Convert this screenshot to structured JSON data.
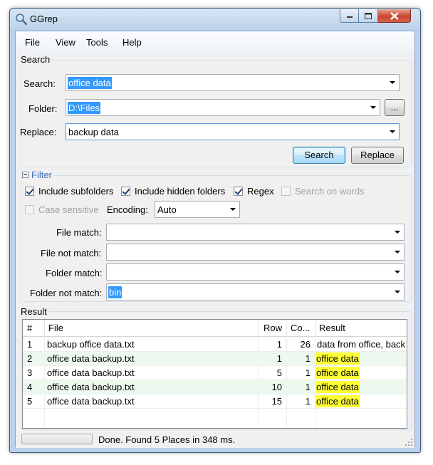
{
  "window": {
    "title": "GGrep"
  },
  "menu": [
    "File",
    "View",
    "Tools",
    "Help"
  ],
  "search_group": {
    "label": "Search",
    "search_label": "Search:",
    "search_value": "office data",
    "folder_label": "Folder:",
    "folder_value": "D:\\Files",
    "browse_label": "...",
    "replace_label": "Replace:",
    "replace_value": "backup data",
    "search_button": "Search",
    "replace_button": "Replace"
  },
  "filter_group": {
    "label": "Filter",
    "include_subfolders": {
      "label": "Include subfolders",
      "checked": true
    },
    "include_hidden": {
      "label": "Include hidden folders",
      "checked": true
    },
    "regex": {
      "label": "Regex",
      "checked": true
    },
    "search_on_words": {
      "label": "Search on words",
      "checked": false
    },
    "case_sensitive": {
      "label": "Case sensitive",
      "checked": false
    },
    "encoding_label": "Encoding:",
    "encoding_value": "Auto",
    "file_match_label": "File match:",
    "file_match_value": "",
    "file_not_match_label": "File not match:",
    "file_not_match_value": "",
    "folder_match_label": "Folder match:",
    "folder_match_value": "",
    "folder_not_match_label": "Folder not match:",
    "folder_not_match_value": "bin"
  },
  "result_group": {
    "label": "Result",
    "columns": [
      "#",
      "File",
      "Row",
      "Co...",
      "Result"
    ],
    "rows": [
      {
        "num": "1",
        "file": "backup office data.txt",
        "row": "1",
        "col": "26",
        "result": "data from office, back",
        "highlight": false
      },
      {
        "num": "2",
        "file": "office data backup.txt",
        "row": "1",
        "col": "1",
        "result": "office data",
        "highlight": true
      },
      {
        "num": "3",
        "file": "office data backup.txt",
        "row": "5",
        "col": "1",
        "result": "office data",
        "highlight": true
      },
      {
        "num": "4",
        "file": "office data backup.txt",
        "row": "10",
        "col": "1",
        "result": "office data",
        "highlight": true
      },
      {
        "num": "5",
        "file": "office data backup.txt",
        "row": "15",
        "col": "1",
        "result": "office data",
        "highlight": true
      }
    ]
  },
  "status": {
    "text": "Done. Found 5 Places in 348 ms."
  },
  "colors": {
    "selection": "#3399ff",
    "highlight": "#ffff33",
    "alt_row": "#edf9ee",
    "close_button": "#c8452f"
  }
}
